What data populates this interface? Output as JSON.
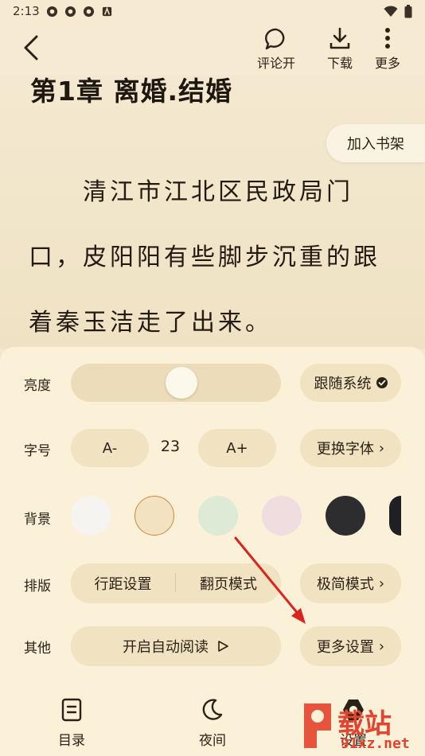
{
  "status": {
    "time": "2:13"
  },
  "topbar": {
    "comment_label": "评论开",
    "download_label": "下载",
    "more_label": "更多"
  },
  "reader": {
    "chapter_title": "第1章 离婚.结婚",
    "shelf_button": "加入书架",
    "lines": [
      "清江市江北区民政局门",
      "口，皮阳阳有些脚步沉重的跟",
      "着秦玉洁走了出来。"
    ]
  },
  "settings": {
    "brightness_label": "亮度",
    "brightness_level": 0.5,
    "follow_system_label": "跟随系统",
    "font_size_label": "字号",
    "font_decrease": "A-",
    "font_size_value": "23",
    "font_increase": "A+",
    "change_font_label": "更换字体",
    "background_label": "背景",
    "background_colors": [
      "#f6f4f1",
      "#f3e2c1",
      "#dcead6",
      "#f0dde0",
      "#2d2d2f",
      "#1e2024"
    ],
    "selected_background": 1,
    "layout_label": "排版",
    "line_spacing_label": "行距设置",
    "page_mode_label": "翻页模式",
    "minimal_mode_label": "极简模式",
    "other_label": "其他",
    "auto_read_label": "开启自动阅读",
    "more_settings_label": "更多设置"
  },
  "bottom_nav": {
    "toc_label": "目录",
    "night_label": "夜间",
    "settings_label": "设置"
  },
  "watermark": {
    "brand": "载站",
    "site": "91xz.net"
  },
  "colors": {
    "page_bg": "#f3e7cc",
    "panel_bg": "#fbf0d8",
    "pill_bg": "#f1e2c1",
    "accent_arrow": "#d8261c"
  }
}
